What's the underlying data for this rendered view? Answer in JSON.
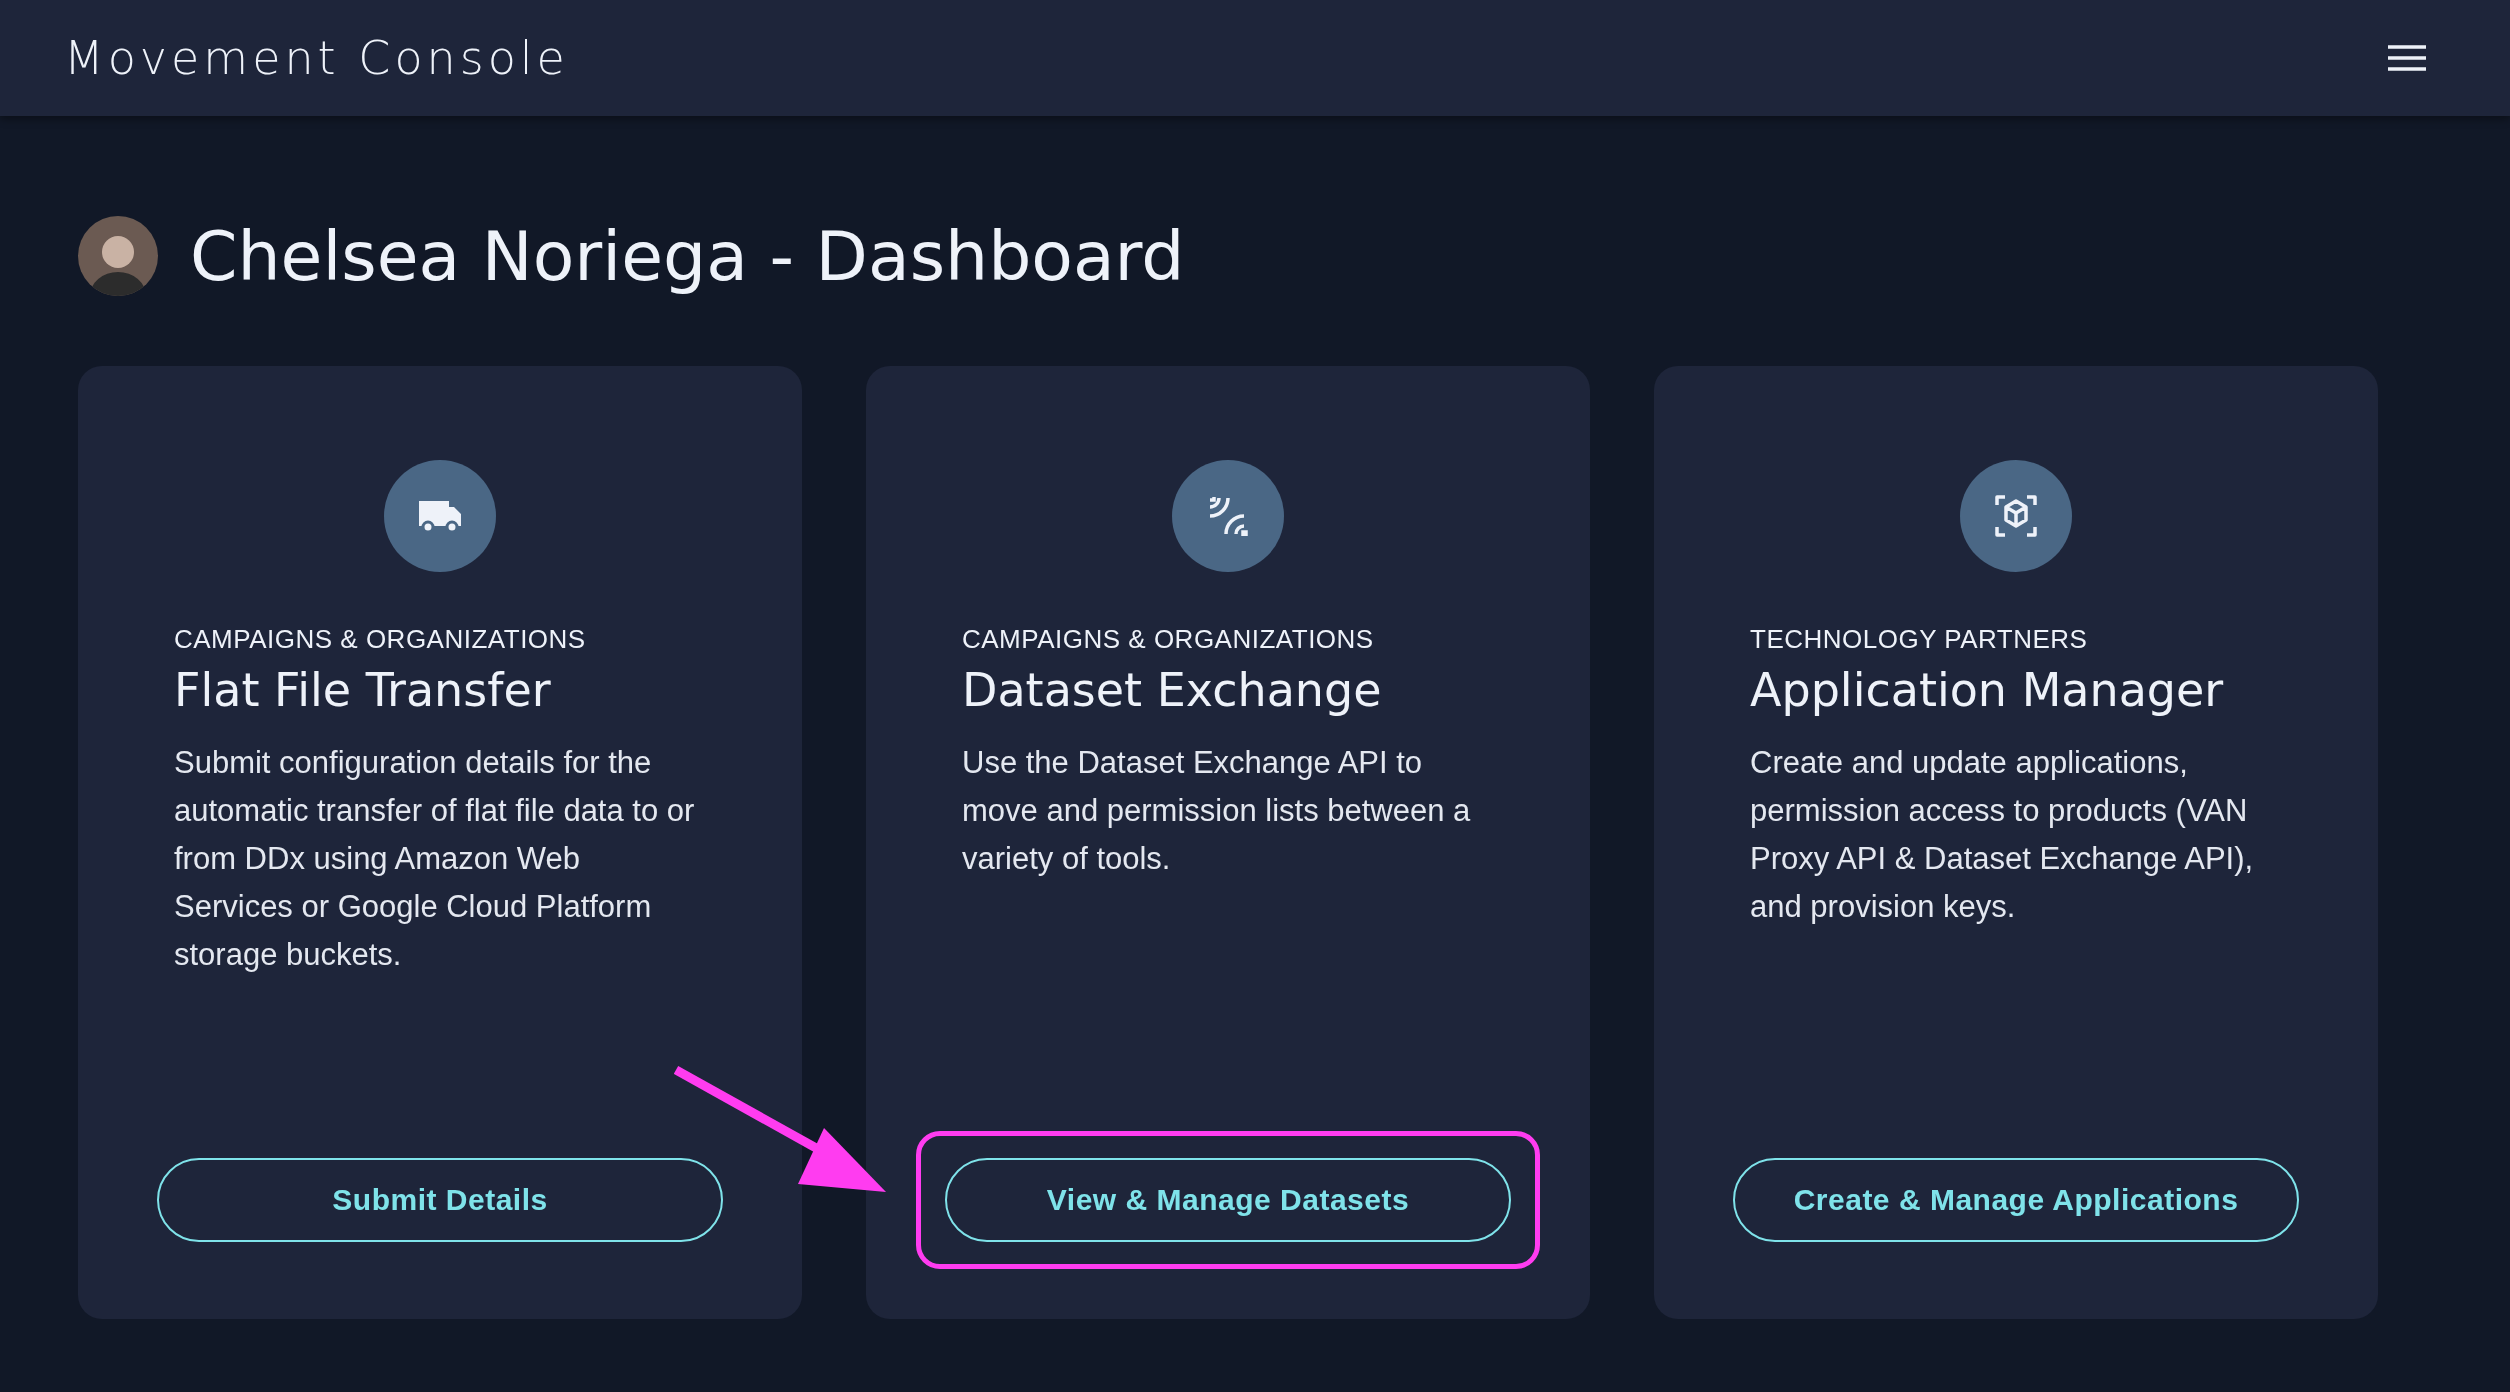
{
  "header": {
    "title": "Movement Console"
  },
  "page": {
    "title": "Chelsea Noriega - Dashboard"
  },
  "cards": [
    {
      "category": "CAMPAIGNS & ORGANIZATIONS",
      "title": "Flat File Transfer",
      "description": "Submit configuration details for the automatic transfer of flat file data to or from DDx using Amazon Web Services or Google Cloud Platform storage buckets.",
      "button": "Submit Details",
      "highlighted": false
    },
    {
      "category": "CAMPAIGNS & ORGANIZATIONS",
      "title": "Dataset Exchange",
      "description": "Use the Dataset Exchange API to move and permission lists between a variety of tools.",
      "button": "View & Manage Datasets",
      "highlighted": true
    },
    {
      "category": "TECHNOLOGY PARTNERS",
      "title": "Application Manager",
      "description": "Create and update applications, permission access to products (VAN Proxy API & Dataset Exchange API), and provision keys.",
      "button": "Create & Manage Applications",
      "highlighted": false
    }
  ],
  "annotation": {
    "arrow": true
  }
}
